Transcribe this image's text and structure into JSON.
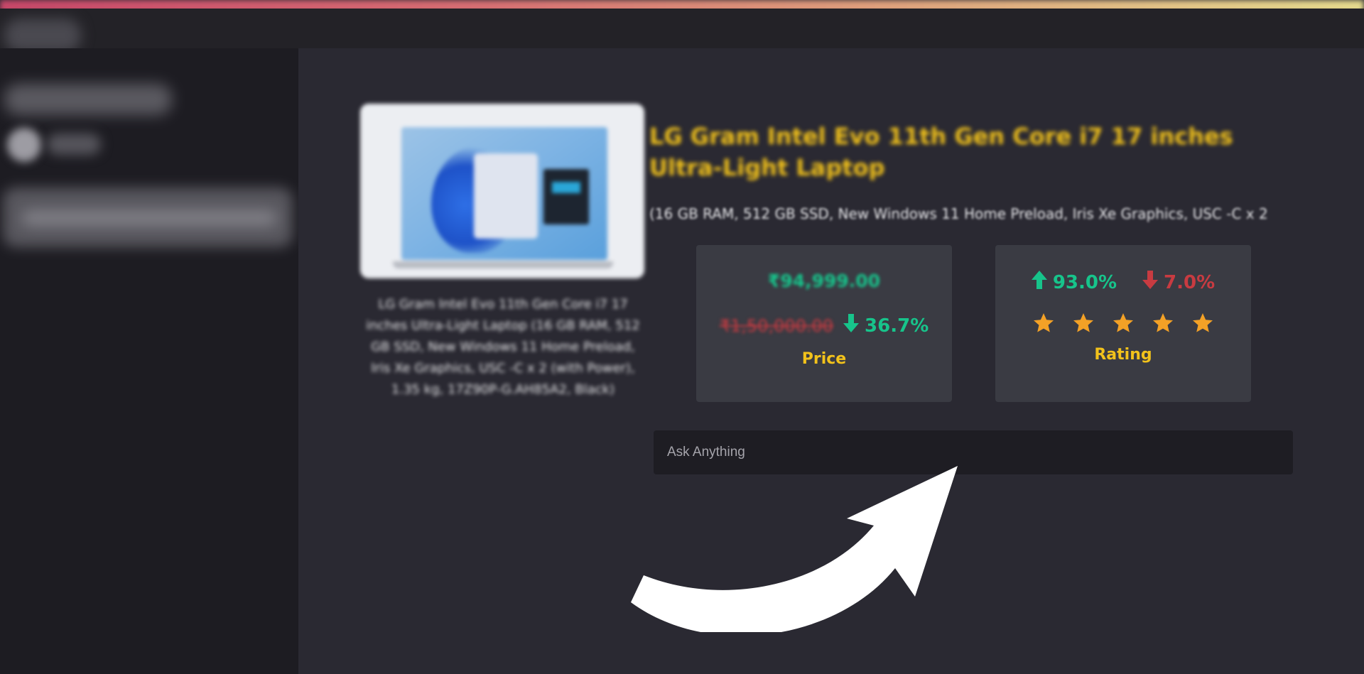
{
  "header": {
    "logo_icon": "app-logo-icon"
  },
  "sidebar": {
    "title": "",
    "toggle_label": "",
    "select_value": ""
  },
  "product": {
    "image_icon": "laptop-image",
    "image_caption": "LG Gram Intel Evo 11th Gen Core i7 17 inches Ultra-Light Laptop (16 GB RAM, 512 GB SSD, New Windows 11 Home Preload, Iris Xe Graphics, USC -C x 2 (with Power), 1.35 kg, 17Z90P-G.AH85A2, Black)",
    "title": "LG Gram Intel Evo 11th Gen Core i7 17 inches Ultra-Light Laptop",
    "subtitle": "(16 GB RAM, 512 GB SSD, New Windows 11 Home Preload, Iris Xe Graphics, USC -C x 2"
  },
  "price_card": {
    "current_price": "₹94,999.00",
    "original_price": "₹1,50,000.00",
    "discount": "36.7%",
    "label": "Price",
    "discount_color": "#17c48b",
    "strike_color": "#c83b41"
  },
  "rating_card": {
    "positive": "93.0%",
    "negative": "7.0%",
    "stars": 5,
    "label": "Rating",
    "star_color": "#f3a126",
    "positive_color": "#17c48b",
    "negative_color": "#c83b41"
  },
  "ask": {
    "placeholder": "Ask Anything",
    "value": ""
  },
  "colors": {
    "accent": "#f2c21b",
    "card_bg": "#3a3b43",
    "page_bg": "#2a2932",
    "sidebar_bg": "#1d1c22"
  }
}
